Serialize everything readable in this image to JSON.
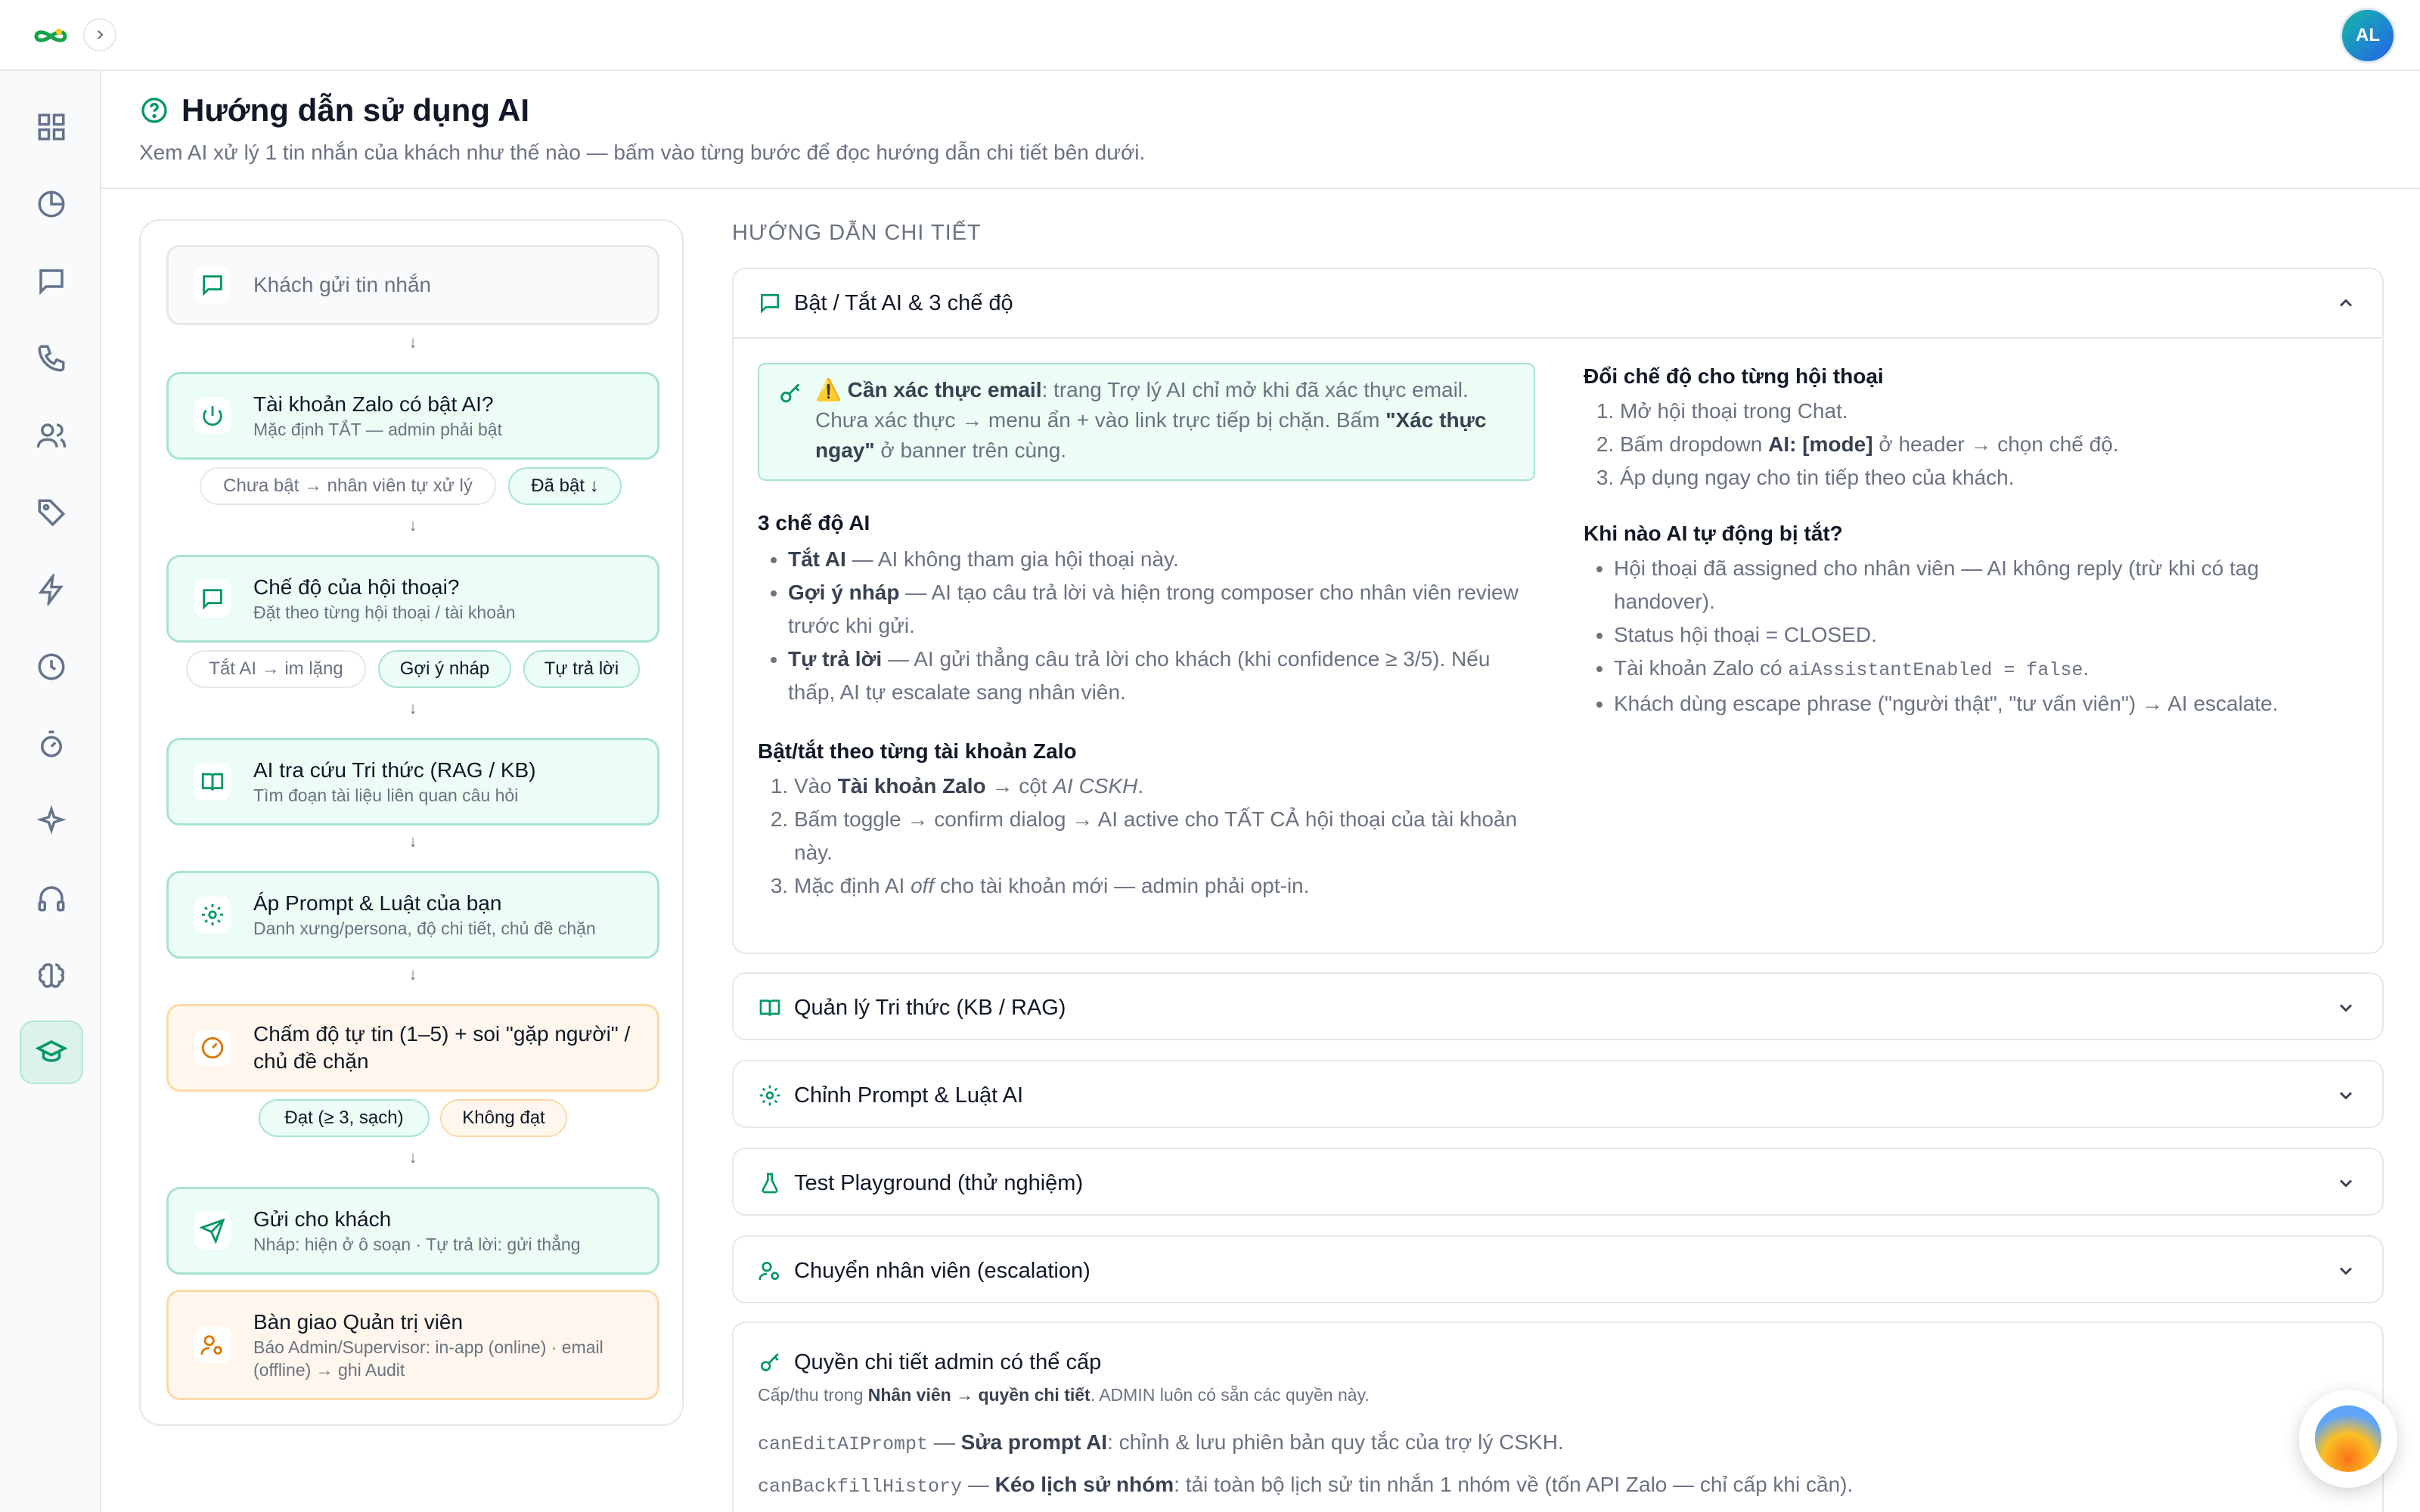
{
  "user": {
    "initials": "AL"
  },
  "header": {
    "title": "Hướng dẫn sử dụng AI",
    "subtitle": "Xem AI xử lý 1 tin nhắn của khách như thế nào — bấm vào từng bước để đọc hướng dẫn chi tiết bên dưới."
  },
  "flow": {
    "step1": {
      "title": "Khách gửi tin nhắn"
    },
    "step2": {
      "title": "Tài khoản Zalo có bật AI?",
      "sub": "Mặc định TẮT — admin phải bật"
    },
    "step2_opts": {
      "off": "Chưa bật → nhân viên tự xử lý",
      "on": "Đã bật ↓"
    },
    "step3": {
      "title": "Chế độ của hội thoại?",
      "sub": "Đặt theo từng hội thoại / tài khoản"
    },
    "step3_opts": {
      "a": "Tắt AI → im lặng",
      "b": "Gợi ý nháp",
      "c": "Tự trả lời"
    },
    "step4": {
      "title": "AI tra cứu Tri thức (RAG / KB)",
      "sub": "Tìm đoạn tài liệu liên quan câu hỏi"
    },
    "step5": {
      "title": "Áp Prompt & Luật của bạn",
      "sub": "Danh xưng/persona, độ chi tiết, chủ đề chặn"
    },
    "step6": {
      "title": "Chấm độ tự tin (1–5) + soi \"gặp người\" / chủ đề chặn"
    },
    "step6_opts": {
      "pass": "Đạt (≥ 3, sạch)",
      "fail": "Không đạt"
    },
    "step7": {
      "title": "Gửi cho khách",
      "sub": "Nháp: hiện ở ô soạn · Tự trả lời: gửi thẳng"
    },
    "step8": {
      "title": "Bàn giao Quản trị viên",
      "sub": "Báo Admin/Supervisor: in-app (online) · email (offline) → ghi Audit"
    }
  },
  "guide": {
    "title": "HƯỚNG DẪN CHI TIẾT",
    "sec1": {
      "title": "Bật / Tắt AI & 3 chế độ",
      "callout_label": "Cần xác thực email",
      "callout_text1": ": trang Trợ lý AI chỉ mở khi đã xác thực email. Chưa xác thực → menu ẩn + vào link trực tiếp bị chặn. Bấm ",
      "callout_btn": "\"Xác thực ngay\"",
      "callout_text2": " ở banner trên cùng.",
      "modes_h": "3 chế độ AI",
      "mode1_b": "Tắt AI",
      "mode1": " — AI không tham gia hội thoại này.",
      "mode2_b": "Gợi ý nháp",
      "mode2": " — AI tạo câu trả lời và hiện trong composer cho nhân viên review trước khi gửi.",
      "mode3_b": "Tự trả lời",
      "mode3": " — AI gửi thẳng câu trả lời cho khách (khi confidence ≥ 3/5). Nếu thấp, AI tự escalate sang nhân viên.",
      "acct_h": "Bật/tắt theo từng tài khoản Zalo",
      "acct1a": "Vào ",
      "acct1b": "Tài khoản Zalo",
      "acct1c": " → cột ",
      "acct1d": "AI CSKH",
      "acct1e": ".",
      "acct2": "Bấm toggle → confirm dialog → AI active cho TẤT CẢ hội thoại của tài khoản này.",
      "acct3a": "Mặc định AI ",
      "acct3b": "off",
      "acct3c": " cho tài khoản mới — admin phải opt-in.",
      "conv_h": "Đổi chế độ cho từng hội thoại",
      "conv1": "Mở hội thoại trong Chat.",
      "conv2a": "Bấm dropdown ",
      "conv2b": "AI: [mode]",
      "conv2c": " ở header → chọn chế độ.",
      "conv3": "Áp dụng ngay cho tin tiếp theo của khách.",
      "auto_h": "Khi nào AI tự động bị tắt?",
      "auto1": "Hội thoại đã assigned cho nhân viên — AI không reply (trừ khi có tag handover).",
      "auto2": "Status hội thoại = CLOSED.",
      "auto3a": "Tài khoản Zalo có ",
      "auto3b": "aiAssistantEnabled = false",
      "auto3c": ".",
      "auto4": "Khách dùng escape phrase (\"người thật\", \"tư vấn viên\") → AI escalate."
    },
    "sec2": {
      "title": "Quản lý Tri thức (KB / RAG)"
    },
    "sec3": {
      "title": "Chỉnh Prompt & Luật AI"
    },
    "sec4": {
      "title": "Test Playground (thử nghiệm)"
    },
    "sec5": {
      "title": "Chuyển nhân viên (escalation)"
    },
    "perm": {
      "title": "Quyền chi tiết admin có thể cấp",
      "sub_a": "Cấp/thu trong ",
      "sub_b": "Nhân viên → quyền chi tiết",
      "sub_c": ". ADMIN luôn có sẵn các quyền này.",
      "p1_code": "canEditAIPrompt",
      "p1_b": "Sửa prompt AI",
      "p1_t": ": chỉnh & lưu phiên bản quy tắc của trợ lý CSKH.",
      "p2_code": "canBackfillHistory",
      "p2_b": "Kéo lịch sử nhóm",
      "p2_t": ": tải toàn bộ lịch sử tin nhắn 1 nhóm về (tốn API Zalo — chỉ cấp khi cần)."
    }
  },
  "colors": {
    "accent": "#059669",
    "accent_bg": "#ecfdf5",
    "warn_bg": "#fff7ed"
  }
}
